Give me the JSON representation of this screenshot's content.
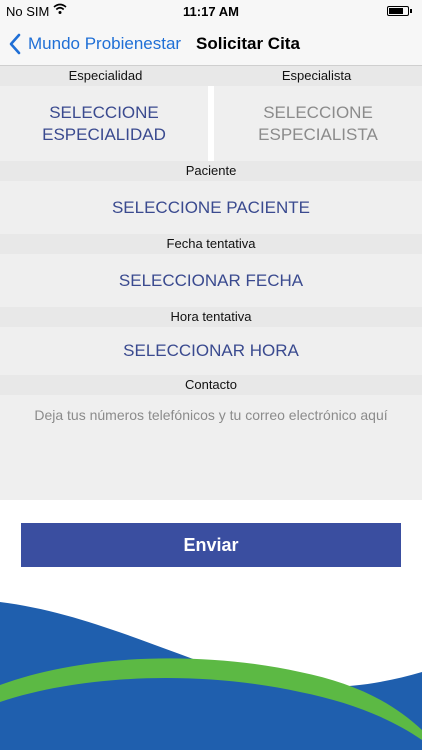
{
  "status_bar": {
    "carrier": "No SIM",
    "time": "11:17 AM",
    "battery_level": 0.8
  },
  "nav": {
    "back_label": "Mundo Probienestar",
    "title": "Solicitar Cita"
  },
  "form": {
    "especialidad": {
      "header": "Especialidad",
      "line1": "SELECCIONE",
      "line2": "ESPECIALIDAD"
    },
    "especialista": {
      "header": "Especialista",
      "line1": "SELECCIONE",
      "line2": "ESPECIALISTA"
    },
    "paciente": {
      "header": "Paciente",
      "value": "SELECCIONE PACIENTE"
    },
    "fecha": {
      "header": "Fecha tentativa",
      "value": "SELECCIONAR FECHA"
    },
    "hora": {
      "header": "Hora tentativa",
      "value": "SELECCIONAR HORA"
    },
    "contacto": {
      "header": "Contacto",
      "placeholder": "Deja tus números telefónicos y tu correo electrónico aquí"
    }
  },
  "submit_label": "Enviar",
  "colors": {
    "accent_blue": "#1f6fd6",
    "button_blue": "#3a4ea0",
    "selector_text": "#3a4a8f",
    "disabled_text": "#8b8b8b",
    "wave_blue": "#1f5fae",
    "wave_green": "#5cb944"
  },
  "icons": {
    "wifi": "wifi-icon",
    "battery": "battery-icon",
    "back": "chevron-left-icon"
  }
}
